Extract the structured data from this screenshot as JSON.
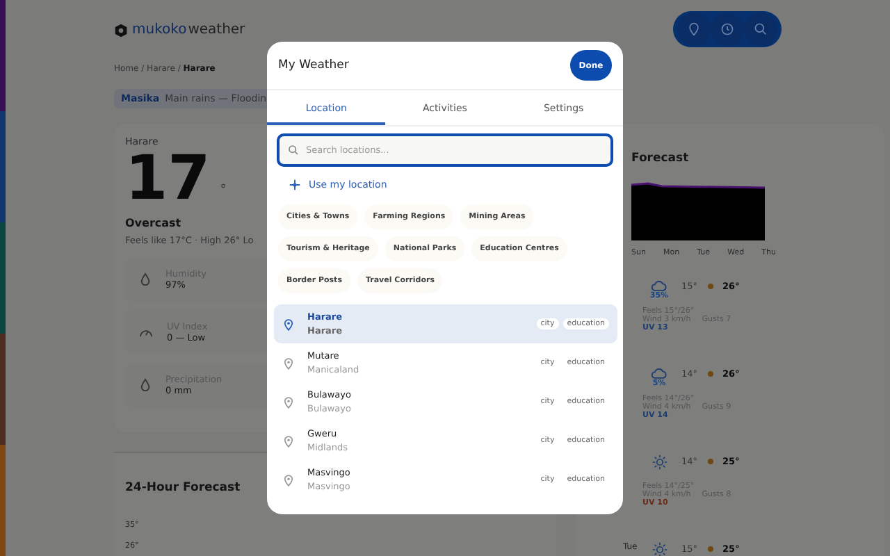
{
  "app": {
    "logo_text": "mukoko",
    "logo_suffix": "weather"
  },
  "breadcrumb": "Home / Harare / **Harare**",
  "season": {
    "name": "Masika",
    "text": "Main rains — Floodin"
  },
  "current": {
    "city": "Harare",
    "temp": "17",
    "unit": "°",
    "condition": "Overcast",
    "summary": "Feels like 17°C · High 26° Lo",
    "metrics": [
      {
        "kind": "drop",
        "label": "Humidity",
        "value": "97%"
      },
      {
        "kind": "gauge",
        "label": "UV Index",
        "value": "0 — Low"
      },
      {
        "kind": "drop",
        "label": "Precipitation",
        "value": "0 mm"
      }
    ]
  },
  "hourly": {
    "title": "24-Hour Forecast",
    "axis_labels": [
      "35°",
      "26°"
    ]
  },
  "daily": {
    "title": "Forecast",
    "chart_labels": [
      "Sun",
      "Mon",
      "Tue",
      "Wed",
      "Thu"
    ],
    "days": [
      {
        "kind": "cloud",
        "rain": "35%",
        "low": "15°",
        "high": "26°",
        "feels": "Feels 15°/26°",
        "wind": "Wind 3 km/h",
        "gusts": "Gusts 7",
        "uv": "UV 13",
        "color": "#1d3d70"
      },
      {
        "kind": "cloud",
        "rain": "5%",
        "low": "14°",
        "high": "26°",
        "feels": "Feels 14°/26°",
        "wind": "Wind 4 km/h",
        "gusts": "Gusts 9",
        "uv": "UV 14",
        "color": "#1d3d70"
      },
      {
        "kind": "sun",
        "low": "14°",
        "high": "25°",
        "feels": "Feels 14°/25°",
        "wind": "Wind 4 km/h",
        "gusts": "Gusts 8",
        "uv": "UV 10",
        "color": "#6a2a18"
      },
      {
        "day": "Tue",
        "kind": "sun",
        "low": "15°",
        "high": "25°"
      }
    ]
  },
  "modal": {
    "title": "My Weather",
    "done": "Done",
    "tabs": [
      {
        "label": "Location",
        "selected": true
      },
      {
        "label": "Activities",
        "selected": false
      },
      {
        "label": "Settings",
        "selected": false
      }
    ],
    "search": {
      "placeholder": "Search locations..."
    },
    "use_location": "Use my location",
    "categories": [
      "Cities & Towns",
      "Farming Regions",
      "Mining Areas",
      "Tourism & Heritage",
      "National Parks",
      "Education Centres",
      "Border Posts",
      "Travel Corridors"
    ],
    "locations": [
      {
        "name": "Harare",
        "region": "Harare",
        "tags": [
          "city",
          "education"
        ],
        "selected": true
      },
      {
        "name": "Mutare",
        "region": "Manicaland",
        "tags": [
          "city",
          "education"
        ],
        "selected": false
      },
      {
        "name": "Bulawayo",
        "region": "Bulawayo",
        "tags": [
          "city",
          "education"
        ],
        "selected": false
      },
      {
        "name": "Gweru",
        "region": "Midlands",
        "tags": [
          "city",
          "education"
        ],
        "selected": false
      },
      {
        "name": "Masvingo",
        "region": "Masvingo",
        "tags": [
          "city",
          "education"
        ],
        "selected": false
      }
    ]
  }
}
